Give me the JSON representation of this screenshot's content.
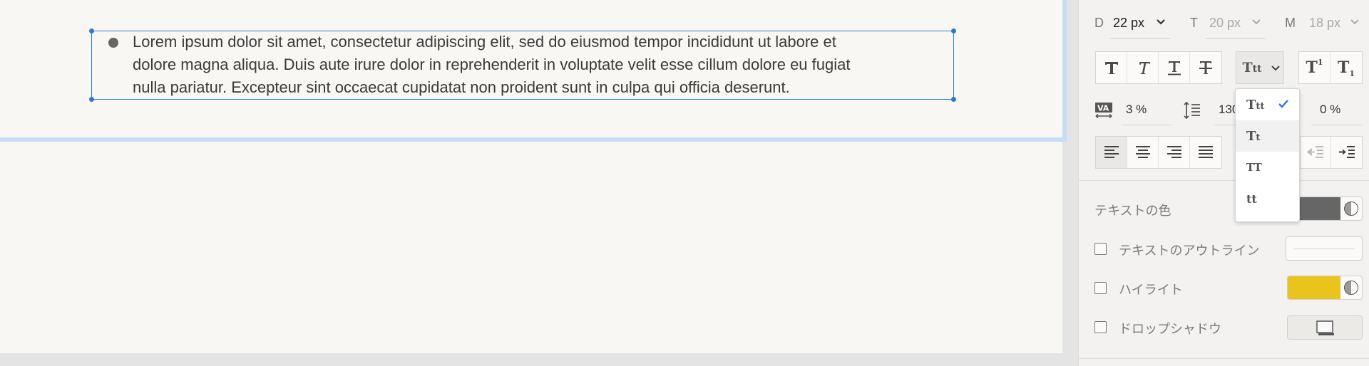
{
  "canvas": {
    "body_text_lines": [
      "Lorem ipsum dolor sit amet, consectetur adipiscing elit, sed do eiusmod tempor incididunt ut labore et",
      "dolore magna aliqua. Duis aute irure dolor in reprehenderit in voluptate velit esse cillum dolore eu fugiat",
      "nulla pariatur. Excepteur sint occaecat cupidatat non proident sunt in culpa qui officia deserunt."
    ]
  },
  "panel": {
    "font_sizes": [
      {
        "label": "D",
        "value": "22 px",
        "active": true
      },
      {
        "label": "T",
        "value": "20 px",
        "active": false
      },
      {
        "label": "M",
        "value": "18 px",
        "active": false
      }
    ],
    "style_buttons": [
      "bold-icon",
      "italic-icon",
      "underline-icon",
      "strikethrough-icon"
    ],
    "case_button": {
      "glyph_big": "T",
      "glyph_small": "tt"
    },
    "script_buttons": {
      "superscript": {
        "base": "T",
        "mark": "1"
      },
      "subscript": {
        "base": "T",
        "mark": "1"
      }
    },
    "spacing": {
      "letter_spacing": "3 %",
      "line_height": "130",
      "paragraph_spacing": "0 %"
    },
    "align_buttons": [
      "align-left-icon",
      "align-center-icon",
      "align-right-icon",
      "align-justify-icon"
    ],
    "indent_buttons": [
      "outdent-icon",
      "indent-icon"
    ],
    "text_color": {
      "label": "テキストの色",
      "color": "#666666"
    },
    "text_outline": {
      "label": "テキストのアウトライン",
      "checked": false
    },
    "highlight": {
      "label": "ハイライト",
      "checked": false,
      "color": "#e9c41d"
    },
    "drop_shadow": {
      "label": "ドロップシャドウ",
      "checked": false
    },
    "accent_color": "#2b79d4"
  },
  "case_dropdown": {
    "items": [
      {
        "big": "T",
        "small": "tt",
        "selected": true
      },
      {
        "big": "T",
        "small": "t",
        "selected": false
      },
      {
        "big": "TT",
        "small": "",
        "selected": false
      },
      {
        "big": "",
        "small": "tt",
        "selected": false
      }
    ]
  }
}
